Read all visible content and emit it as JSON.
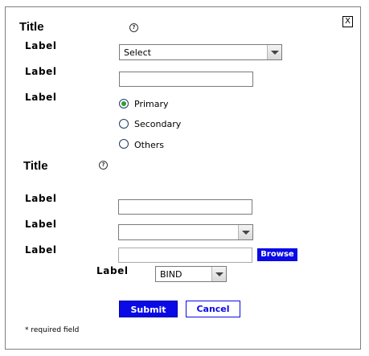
{
  "dialog": {
    "close_label": "X",
    "section1": {
      "title": "Title",
      "help_glyph": "?",
      "field1": {
        "label": "Label",
        "select_value": "Select"
      },
      "field2": {
        "label": "Label",
        "value": ""
      },
      "field3": {
        "label": "Label",
        "options": [
          "Primary",
          "Secondary",
          "Others"
        ],
        "selected": "Primary"
      }
    },
    "section2": {
      "title": "Title",
      "help_glyph": "?",
      "field1": {
        "label": "Label",
        "value": ""
      },
      "field2": {
        "label": "Label",
        "select_value": ""
      },
      "field3": {
        "label": "Label",
        "value": "",
        "browse_label": "Browse"
      },
      "field4": {
        "label": "Label",
        "select_value": "BIND"
      }
    },
    "buttons": {
      "submit": "Submit",
      "cancel": "Cancel"
    },
    "footnote": "* required field"
  },
  "icons": [
    "close-icon",
    "help-icon",
    "chevron-down-icon"
  ],
  "colors": {
    "accent": "#0a0ae6",
    "radio_selected": "#2e9e2e"
  }
}
